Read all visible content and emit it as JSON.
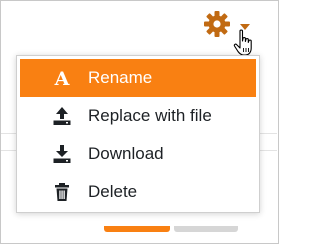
{
  "colors": {
    "accent": "#f98012",
    "gear": "#c16a12",
    "text": "#1d2125",
    "active_text": "#ffffff"
  },
  "trigger": {
    "icon": "gear-icon",
    "caret_icon": "caret-down-icon"
  },
  "menu": {
    "items": [
      {
        "label": "Rename",
        "icon": "rename-icon",
        "active": true
      },
      {
        "label": "Replace with file",
        "icon": "upload-icon",
        "active": false
      },
      {
        "label": "Download",
        "icon": "download-icon",
        "active": false
      },
      {
        "label": "Delete",
        "icon": "trash-icon",
        "active": false
      }
    ]
  }
}
